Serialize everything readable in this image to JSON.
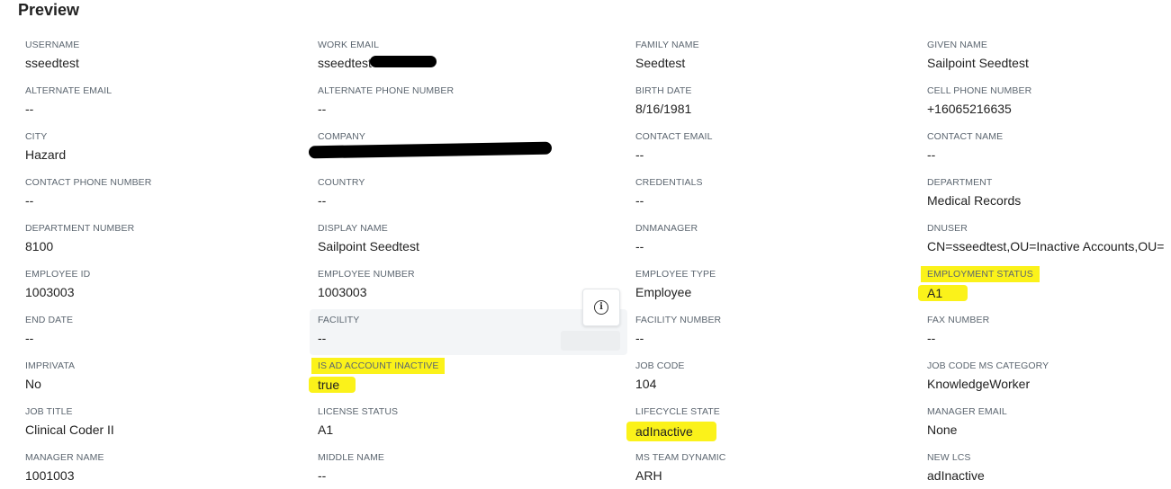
{
  "page": {
    "title": "Preview"
  },
  "fields": [
    {
      "label": "USERNAME",
      "value": "sseedtest"
    },
    {
      "label": "WORK EMAIL",
      "value": "sseedtest"
    },
    {
      "label": "FAMILY NAME",
      "value": "Seedtest"
    },
    {
      "label": "GIVEN NAME",
      "value": "Sailpoint Seedtest"
    },
    {
      "label": "ALTERNATE EMAIL",
      "value": "--"
    },
    {
      "label": "ALTERNATE PHONE NUMBER",
      "value": "--"
    },
    {
      "label": "BIRTH DATE",
      "value": "8/16/1981"
    },
    {
      "label": "CELL PHONE NUMBER",
      "value": "+16065216635"
    },
    {
      "label": "CITY",
      "value": "Hazard"
    },
    {
      "label": "COMPANY",
      "value": ""
    },
    {
      "label": "CONTACT EMAIL",
      "value": "--"
    },
    {
      "label": "CONTACT NAME",
      "value": "--"
    },
    {
      "label": "CONTACT PHONE NUMBER",
      "value": "--"
    },
    {
      "label": "COUNTRY",
      "value": "--"
    },
    {
      "label": "CREDENTIALS",
      "value": "--"
    },
    {
      "label": "DEPARTMENT",
      "value": "Medical Records"
    },
    {
      "label": "DEPARTMENT NUMBER",
      "value": "8100"
    },
    {
      "label": "DISPLAY NAME",
      "value": "Sailpoint Seedtest"
    },
    {
      "label": "DNMANAGER",
      "value": "--"
    },
    {
      "label": "DNUSER",
      "value": "CN=sseedtest,OU=Inactive Accounts,OU="
    },
    {
      "label": "EMPLOYEE ID",
      "value": "1003003"
    },
    {
      "label": "EMPLOYEE NUMBER",
      "value": "1003003"
    },
    {
      "label": "EMPLOYEE TYPE",
      "value": "Employee"
    },
    {
      "label": "EMPLOYMENT STATUS",
      "value": "A1"
    },
    {
      "label": "END DATE",
      "value": "--"
    },
    {
      "label": "FACILITY",
      "value": "--"
    },
    {
      "label": "FACILITY NUMBER",
      "value": "--"
    },
    {
      "label": "FAX NUMBER",
      "value": "--"
    },
    {
      "label": "IMPRIVATA",
      "value": "No"
    },
    {
      "label": "IS AD ACCOUNT INACTIVE",
      "value": "true"
    },
    {
      "label": "JOB CODE",
      "value": "104"
    },
    {
      "label": "JOB CODE MS CATEGORY",
      "value": "KnowledgeWorker"
    },
    {
      "label": "JOB TITLE",
      "value": "Clinical Coder II"
    },
    {
      "label": "LICENSE STATUS",
      "value": "A1"
    },
    {
      "label": "LIFECYCLE STATE",
      "value": "adInactive"
    },
    {
      "label": "MANAGER EMAIL",
      "value": "None"
    },
    {
      "label": "MANAGER NAME",
      "value": "1001003"
    },
    {
      "label": "MIDDLE NAME",
      "value": "--"
    },
    {
      "label": "MS TEAM DYNAMIC",
      "value": "ARH"
    },
    {
      "label": "NEW LCS",
      "value": "adInactive"
    }
  ],
  "info_button": {
    "icon": "info-icon"
  },
  "colors": {
    "highlight": "#fbf21a",
    "label": "#5c6670",
    "value": "#222222",
    "hover_bg": "#f3f5f7"
  }
}
